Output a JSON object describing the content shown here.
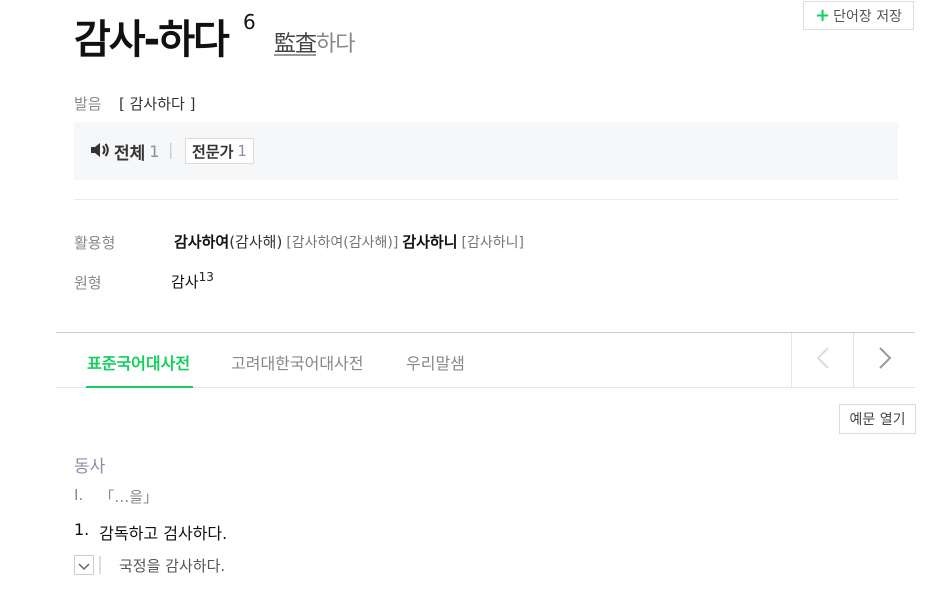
{
  "entry": {
    "headword": "감사-하다",
    "homonym_number": "6",
    "hanja": "監査",
    "hanja_suffix": "하다"
  },
  "save_button": {
    "label": "단어장 저장",
    "icon": "plus-icon"
  },
  "pronunciation": {
    "label": "발음",
    "value": "[ 감사하다 ]",
    "audio_all_label": "전체",
    "audio_all_count": "1",
    "separator": "|",
    "audio_expert_label": "전문가",
    "audio_expert_count": "1"
  },
  "conjugation": {
    "label": "활용형",
    "forms": [
      {
        "form": "감사하여",
        "paren": "(감사해)",
        "pron": "[감사하여(감사해)]"
      },
      {
        "form": "감사하니",
        "paren": "",
        "pron": "[감사하니]"
      }
    ]
  },
  "original": {
    "label": "원형",
    "value": "감사",
    "sup": "13"
  },
  "tabs": [
    {
      "label": "표준국어대사전",
      "active": true
    },
    {
      "label": "고려대한국어대사전",
      "active": false
    },
    {
      "label": "우리말샘",
      "active": false
    }
  ],
  "example_toggle_button": {
    "label": "예문 열기"
  },
  "definition": {
    "pos": "동사",
    "pattern_num": "Ⅰ.",
    "pattern": "「…을」",
    "sense_num": "1.",
    "sense_text": "감독하고 검사하다.",
    "example": "국정을 감사하다."
  },
  "colors": {
    "accent": "#19ce60",
    "muted": "#8a8fa8"
  }
}
